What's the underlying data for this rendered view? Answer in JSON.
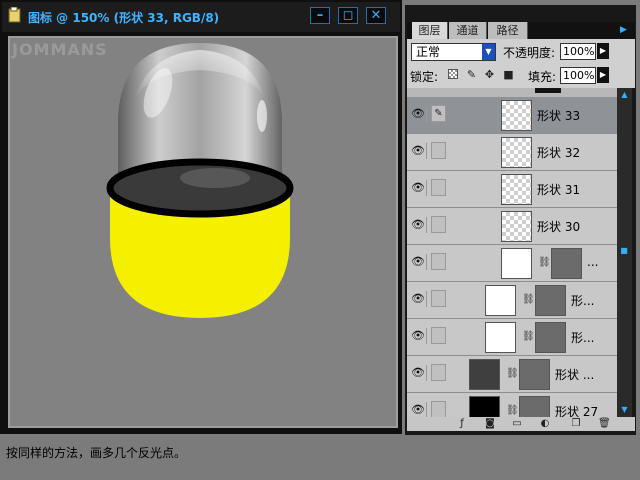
{
  "document": {
    "title": "图标 @ 150% (形状 33, RGB/8)",
    "watermark": "JOMMANS",
    "buttons": {
      "minimize": "–",
      "restore": "◻",
      "close": "✕"
    }
  },
  "layers_panel": {
    "tabs": [
      "图层",
      "通道",
      "路径"
    ],
    "blend_mode": "正常",
    "opacity_label": "不透明度:",
    "opacity_value": "100%",
    "lock_label": "锁定:",
    "fill_label": "填充:",
    "fill_value": "100%",
    "layers": [
      {
        "name": "形状 33",
        "selected": true
      },
      {
        "name": "形状 32",
        "selected": false
      },
      {
        "name": "形状 31",
        "selected": false
      },
      {
        "name": "形状 30",
        "selected": false
      },
      {
        "name": "...",
        "selected": false
      },
      {
        "name": "形...",
        "selected": false
      },
      {
        "name": "形...",
        "selected": false
      },
      {
        "name": "形状 ...",
        "selected": false
      },
      {
        "name": "形状 27",
        "selected": false
      }
    ]
  },
  "caption": "按同样的方法，画多几个反光点。",
  "colors": {
    "accent": "#35aef7",
    "capsule_yellow": "#f5f000",
    "selected_row": "#8f9397"
  }
}
